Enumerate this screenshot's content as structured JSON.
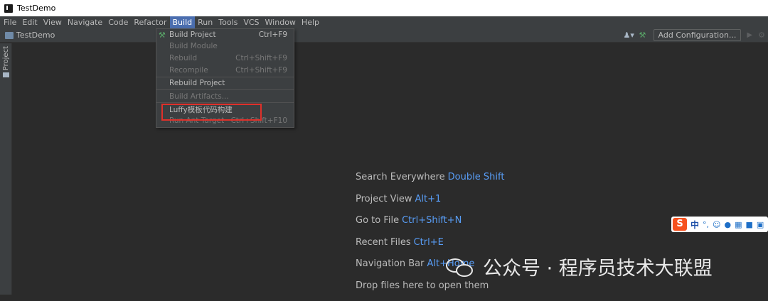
{
  "window": {
    "title": "TestDemo"
  },
  "menubar": {
    "items": [
      {
        "label": "File"
      },
      {
        "label": "Edit"
      },
      {
        "label": "View"
      },
      {
        "label": "Navigate"
      },
      {
        "label": "Code"
      },
      {
        "label": "Refactor"
      },
      {
        "label": "Build"
      },
      {
        "label": "Run"
      },
      {
        "label": "Tools"
      },
      {
        "label": "VCS"
      },
      {
        "label": "Window"
      },
      {
        "label": "Help"
      }
    ],
    "active": "Build"
  },
  "navbar": {
    "breadcrumb": "TestDemo",
    "add_config_label": "Add Configuration..."
  },
  "toolwindow": {
    "project_label": "Project"
  },
  "build_menu": {
    "items": [
      {
        "label": "Build Project",
        "shortcut": "Ctrl+F9",
        "enabled": true,
        "icon": "hammer-icon"
      },
      {
        "label": "Build Module",
        "shortcut": "",
        "enabled": false
      },
      {
        "label": "Rebuild",
        "shortcut": "Ctrl+Shift+F9",
        "enabled": false
      },
      {
        "label": "Recompile",
        "shortcut": "Ctrl+Shift+F9",
        "enabled": false
      },
      {
        "label": "Rebuild Project",
        "shortcut": "",
        "enabled": true
      },
      {
        "label": "Build Artifacts...",
        "shortcut": "",
        "enabled": false
      },
      {
        "label": "Luffy模板代码构建",
        "shortcut": "",
        "enabled": true
      },
      {
        "label": "Run Ant Target",
        "shortcut": "Ctrl+Shift+F10",
        "enabled": false
      }
    ]
  },
  "editor_hints": [
    {
      "text": "Search Everywhere",
      "key": "Double Shift"
    },
    {
      "text": "Project View",
      "key": "Alt+1"
    },
    {
      "text": "Go to File",
      "key": "Ctrl+Shift+N"
    },
    {
      "text": "Recent Files",
      "key": "Ctrl+E"
    },
    {
      "text": "Navigation Bar",
      "key": "Alt+Home"
    },
    {
      "text": "Drop files here to open them",
      "key": ""
    }
  ],
  "ime_bar": {
    "logo": "S",
    "mode": "中"
  },
  "watermark": {
    "text": "公众号 · 程序员技术大联盟"
  },
  "colors": {
    "accent": "#4b6eaf",
    "link": "#589df6",
    "highlight_border": "#e0302a"
  }
}
